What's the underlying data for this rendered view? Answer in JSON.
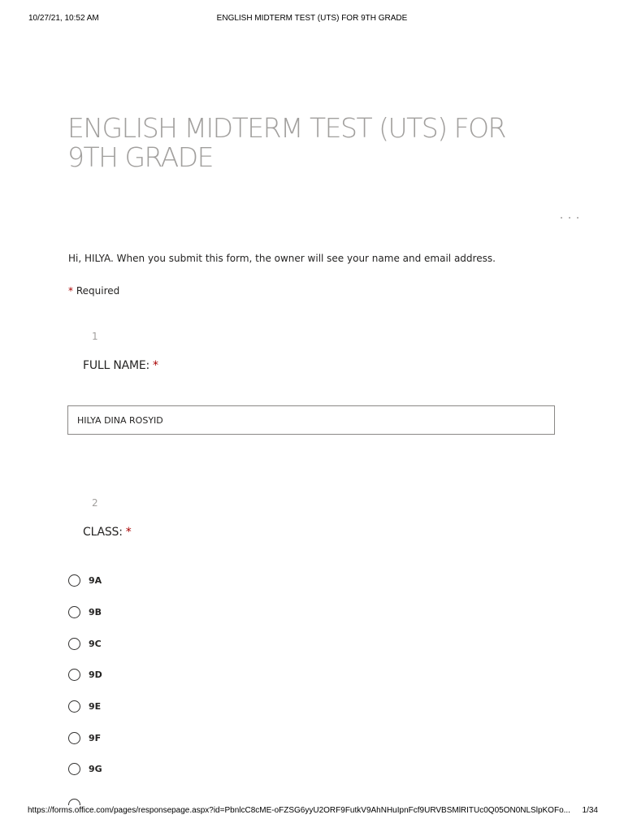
{
  "print_header": {
    "datetime": "10/27/21, 10:52 AM",
    "title": "ENGLISH MIDTERM TEST (UTS) FOR 9TH GRADE"
  },
  "form": {
    "title": "ENGLISH MIDTERM TEST (UTS) FOR 9TH GRADE",
    "more_icon": "more-horizontal-icon",
    "notice": "Hi, HILYA. When you submit this form, the owner will see your name and email address.",
    "required_marker": "*",
    "required_label": "Required"
  },
  "questions": [
    {
      "number": "1",
      "title": "FULL NAME:",
      "required_marker": "*",
      "answer": "HILYA DINA ROSYID"
    },
    {
      "number": "2",
      "title": "CLASS:",
      "required_marker": "*",
      "options": [
        "9A",
        "9B",
        "9C",
        "9D",
        "9E",
        "9F",
        "9G"
      ],
      "selected": null
    }
  ],
  "print_footer": {
    "url": "https://forms.office.com/pages/responsepage.aspx?id=PbnlcC8cME-oFZSG6yyU2ORF9FutkV9AhNHuIpnFcf9URVBSMlRITUc0Q05ON0NLSlpKOFo...",
    "page": "1/34"
  }
}
